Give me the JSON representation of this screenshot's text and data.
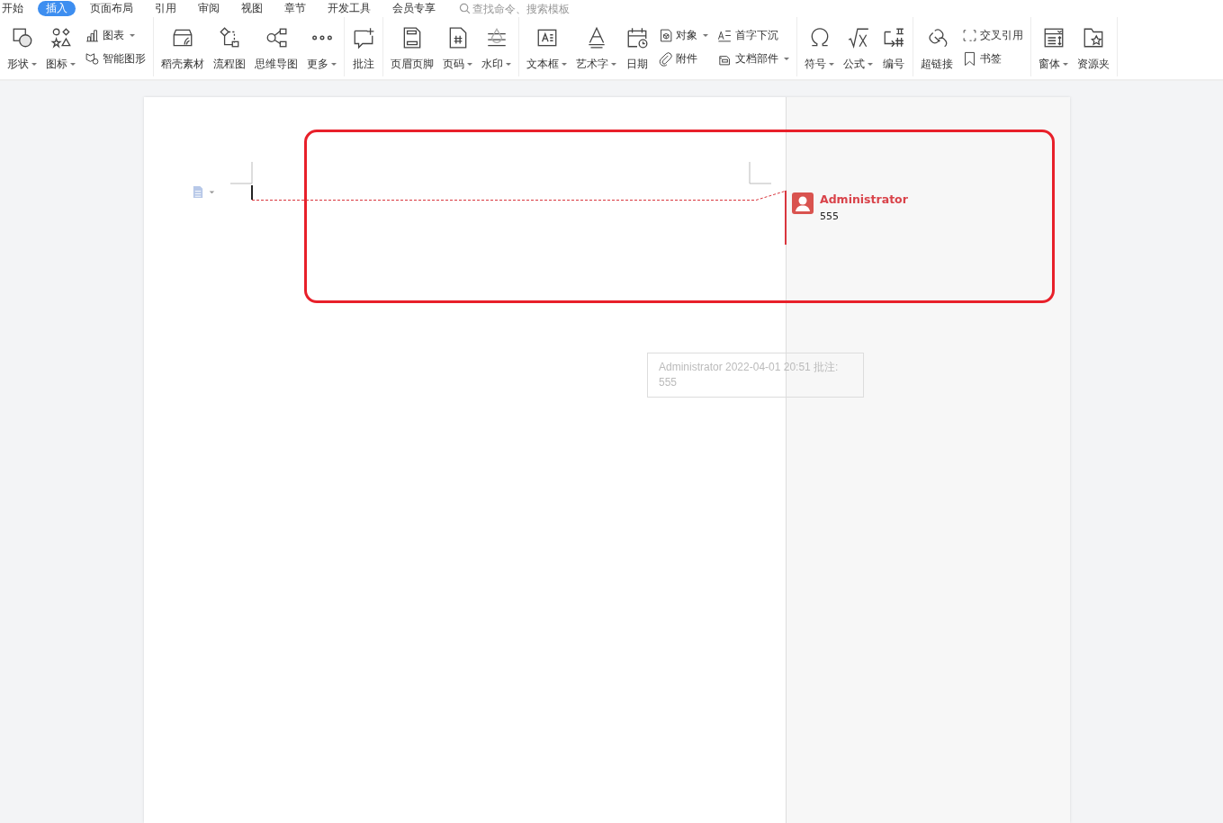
{
  "menu": {
    "tabs": [
      {
        "label": "开始",
        "selected": false
      },
      {
        "label": "插入",
        "selected": true
      },
      {
        "label": "页面布局",
        "selected": false
      },
      {
        "label": "引用",
        "selected": false
      },
      {
        "label": "审阅",
        "selected": false
      },
      {
        "label": "视图",
        "selected": false
      },
      {
        "label": "章节",
        "selected": false
      },
      {
        "label": "开发工具",
        "selected": false
      },
      {
        "label": "会员专享",
        "selected": false
      }
    ],
    "search": {
      "placeholder": "查找命令、搜索模板"
    }
  },
  "toolbar": {
    "groups": [
      {
        "items": [
          {
            "kind": "large",
            "label": "形状",
            "dropdown": true
          },
          {
            "kind": "large",
            "label": "图标",
            "dropdown": true
          },
          {
            "kind": "stack",
            "items": [
              {
                "label": "图表",
                "dropdown": true
              },
              {
                "label": "智能图形",
                "dropdown": false
              }
            ]
          }
        ]
      },
      {
        "items": [
          {
            "kind": "large",
            "label": "稻壳素材",
            "dropdown": false
          },
          {
            "kind": "large",
            "label": "流程图",
            "dropdown": false
          },
          {
            "kind": "large",
            "label": "思维导图",
            "dropdown": false
          },
          {
            "kind": "large",
            "label": "更多",
            "dropdown": true
          }
        ]
      },
      {
        "items": [
          {
            "kind": "large",
            "label": "批注",
            "dropdown": false
          }
        ]
      },
      {
        "items": [
          {
            "kind": "large",
            "label": "页眉页脚",
            "dropdown": false
          },
          {
            "kind": "large",
            "label": "页码",
            "dropdown": true
          },
          {
            "kind": "large",
            "label": "水印",
            "dropdown": true
          }
        ]
      },
      {
        "items": [
          {
            "kind": "large",
            "label": "文本框",
            "dropdown": true
          },
          {
            "kind": "large",
            "label": "艺术字",
            "dropdown": true
          },
          {
            "kind": "large",
            "label": "日期",
            "dropdown": false
          },
          {
            "kind": "stack",
            "items": [
              {
                "label": "对象",
                "dropdown": true
              },
              {
                "label": "附件",
                "dropdown": false
              }
            ]
          },
          {
            "kind": "stack",
            "items": [
              {
                "label": "首字下沉",
                "dropdown": false
              },
              {
                "label": "文档部件",
                "dropdown": true
              }
            ]
          }
        ]
      },
      {
        "items": [
          {
            "kind": "large",
            "label": "符号",
            "dropdown": true
          },
          {
            "kind": "large",
            "label": "公式",
            "dropdown": true
          },
          {
            "kind": "large",
            "label": "编号",
            "dropdown": false
          }
        ]
      },
      {
        "items": [
          {
            "kind": "large",
            "label": "超链接",
            "dropdown": false
          },
          {
            "kind": "stack",
            "items": [
              {
                "label": "交叉引用",
                "dropdown": false
              },
              {
                "label": "书签",
                "dropdown": false
              }
            ]
          }
        ]
      },
      {
        "items": [
          {
            "kind": "large",
            "label": "窗体",
            "dropdown": true
          },
          {
            "kind": "large",
            "label": "资源夹",
            "dropdown": false
          }
        ]
      }
    ]
  },
  "comment": {
    "author": "Administrator",
    "text": "555"
  },
  "tooltip": {
    "header": "Administrator 2022-04-01 20:51 批注:",
    "text": "555"
  }
}
